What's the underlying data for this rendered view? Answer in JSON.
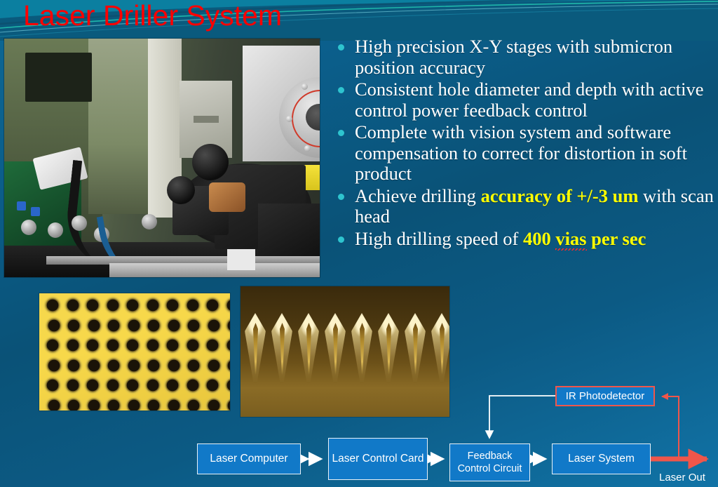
{
  "slide": {
    "title": "Laser Driller System",
    "title_color": "#ff0000",
    "background_colors": [
      "#0d6895",
      "#0a5277",
      "#1173a6"
    ],
    "accent_colors": {
      "bullet_dot": "#2ec4cf",
      "highlight_text": "#ffff00",
      "node_fill": "#1179c8",
      "node_border": "#e8f1f8",
      "ir_border": "#f0564a",
      "laser_beam": "#f0564a"
    }
  },
  "bullets": [
    {
      "segments": [
        {
          "text": "High precision X-Y stages with submicron position accuracy",
          "style": "normal"
        }
      ]
    },
    {
      "segments": [
        {
          "text": "Consistent hole diameter and depth with active control power feedback control",
          "style": "normal"
        }
      ]
    },
    {
      "segments": [
        {
          "text": "Complete with vision system and software compensation to correct for distortion in soft product",
          "style": "normal"
        }
      ]
    },
    {
      "segments": [
        {
          "text": "Achieve drilling ",
          "style": "normal"
        },
        {
          "text": "accuracy of +/-3 um",
          "style": "highlight"
        },
        {
          "text": " with scan head",
          "style": "normal"
        }
      ]
    },
    {
      "segments": [
        {
          "text": "High drilling speed of ",
          "style": "normal"
        },
        {
          "text": "400 ",
          "style": "highlight"
        },
        {
          "text": "vias",
          "style": "highlight-spellcheck"
        },
        {
          "text": " per sec",
          "style": "highlight"
        }
      ]
    }
  ],
  "images": [
    {
      "name": "laser-driller-machine-photo",
      "caption": ""
    },
    {
      "name": "drilled-via-array-photo",
      "caption": ""
    },
    {
      "name": "via-cross-section-photo",
      "caption": ""
    }
  ],
  "diagram": {
    "nodes": [
      {
        "id": "laser-computer",
        "label": "Laser Computer"
      },
      {
        "id": "laser-control-card",
        "label": "Laser Control Card"
      },
      {
        "id": "feedback-control-circuit",
        "label": "Feedback Control Circuit"
      },
      {
        "id": "laser-system",
        "label": "Laser System"
      },
      {
        "id": "ir-photodetector",
        "label": "IR Photodetector"
      }
    ],
    "labels": [
      {
        "id": "laser-out",
        "label": "Laser Out"
      }
    ],
    "connections": [
      {
        "from": "laser-computer",
        "to": "laser-control-card",
        "type": "bidirectional",
        "color": "#ffffff"
      },
      {
        "from": "laser-control-card",
        "to": "feedback-control-circuit",
        "type": "bidirectional",
        "color": "#ffffff"
      },
      {
        "from": "feedback-control-circuit",
        "to": "laser-system",
        "type": "bidirectional",
        "color": "#ffffff"
      },
      {
        "from": "ir-photodetector",
        "to": "feedback-control-circuit",
        "type": "directional",
        "color": "#ffffff"
      },
      {
        "from": "laser-system",
        "to": "laser-out",
        "type": "directional",
        "color": "#f0564a"
      },
      {
        "from": "laser-out",
        "to": "ir-photodetector",
        "type": "directional",
        "color": "#f0564a"
      }
    ]
  }
}
